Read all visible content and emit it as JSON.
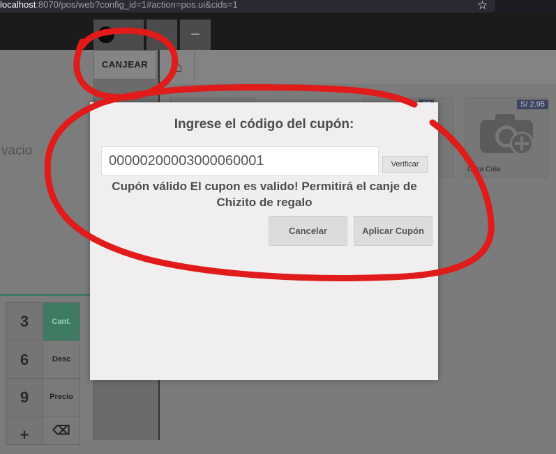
{
  "browser": {
    "url_host": "localhost",
    "url_rest": ":8070/pos/web?config_id=1#action=pos.ui&cids=1",
    "bookmark_icon": "star-icon"
  },
  "header": {
    "minus_label": "−"
  },
  "toolbar": {
    "redeem_label": "CANJEAR",
    "home_icon": "home-icon"
  },
  "order": {
    "empty_text": "vacio"
  },
  "products": [
    {
      "name": "Coca Cola",
      "price": "S/ 2.95"
    },
    {
      "name": "",
      "price": "00"
    }
  ],
  "numpad": {
    "keys": [
      "3",
      "6",
      "9",
      "+"
    ],
    "ops": [
      "Cant.",
      "Desc",
      "Precio",
      "⌫"
    ],
    "active_color": "#3f7a62"
  },
  "dialog": {
    "title": "Ingrese el código del cupón:",
    "coupon_value": "00000200003000060001",
    "verify_label": "Verificar",
    "message": "Cupón válido El cupon es valido! Permitirá el canje de Chizito de regalo",
    "cancel_label": "Cancelar",
    "apply_label": "Aplicar Cupón"
  },
  "annotation_color": "#e11a1a"
}
